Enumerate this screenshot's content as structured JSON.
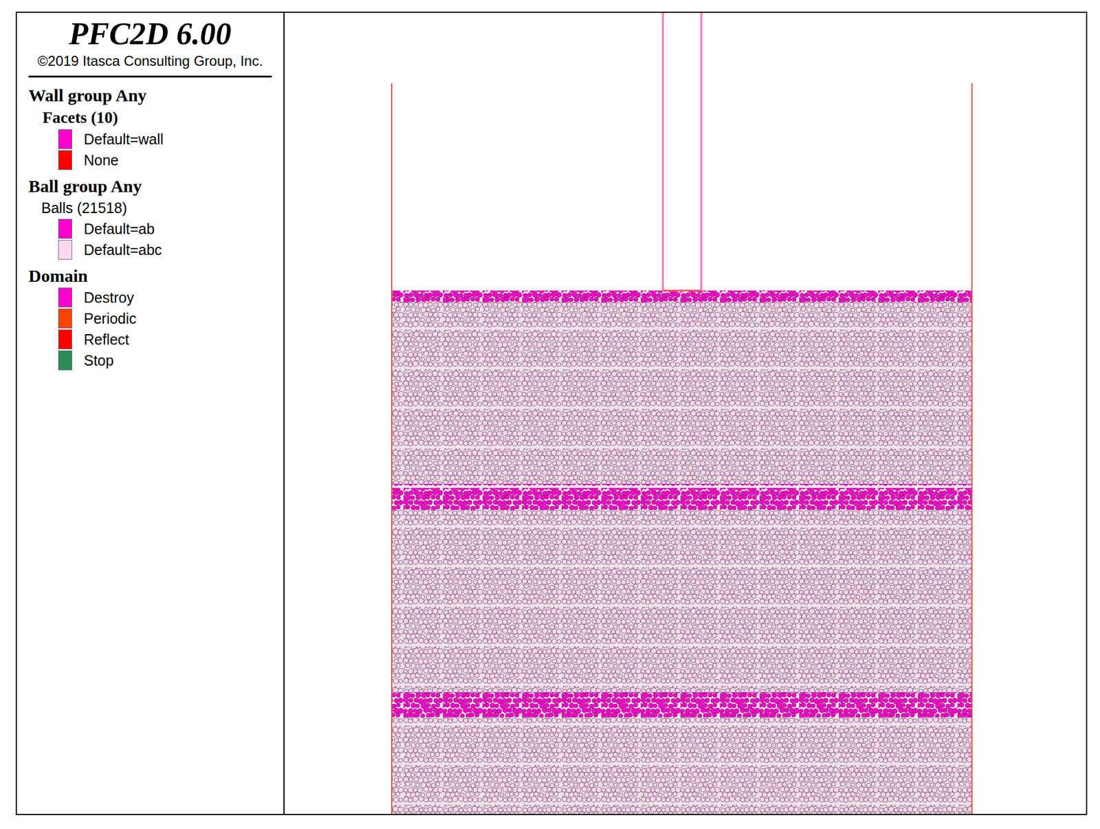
{
  "title": "PFC2D 6.00",
  "copyright": "©2019 Itasca Consulting Group, Inc.",
  "legend": [
    {
      "heading": "Wall group Any",
      "subheading": {
        "text": "Facets (10)",
        "kind": "bold"
      },
      "items": [
        {
          "label": "Default=wall",
          "color": "#ff00cc"
        },
        {
          "label": "None",
          "color": "#ff0000"
        }
      ]
    },
    {
      "heading": "Ball group Any",
      "subheading": {
        "text": "Balls (21518)",
        "kind": "plain"
      },
      "items": [
        {
          "label": "Default=ab",
          "color": "#ff00cc"
        },
        {
          "label": "Default=abc",
          "color": "#ffd6f0"
        }
      ]
    },
    {
      "heading": "Domain",
      "items": [
        {
          "label": "Destroy",
          "color": "#ff00cc"
        },
        {
          "label": "Periodic",
          "color": "#ff4500"
        },
        {
          "label": "Reflect",
          "color": "#ff0000"
        },
        {
          "label": "Stop",
          "color": "#2e8b57"
        }
      ]
    }
  ],
  "model": {
    "container_wall_color": "#ff4d4d",
    "punch_wall_color": "#ff6fa8",
    "layers": [
      {
        "group": "ab",
        "color": "#ff00cc"
      },
      {
        "group": "abc",
        "color": "#ffd6f0"
      },
      {
        "group": "ab",
        "color": "#ff00cc"
      },
      {
        "group": "abc",
        "color": "#ffd6f0"
      },
      {
        "group": "ab",
        "color": "#ff00cc"
      },
      {
        "group": "abc",
        "color": "#ffd6f0"
      }
    ]
  }
}
